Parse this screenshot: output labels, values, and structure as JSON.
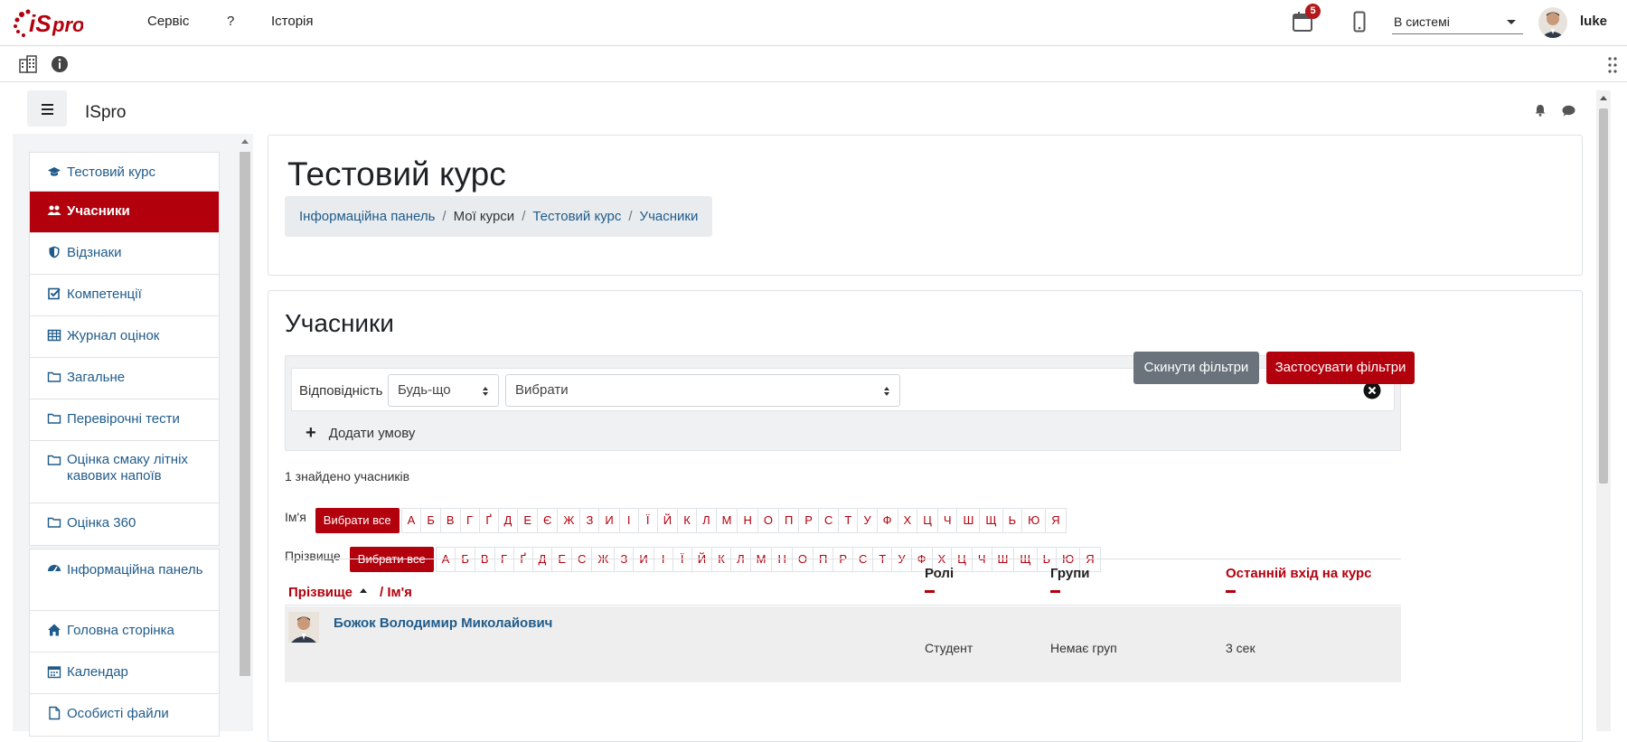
{
  "topbar": {
    "logo_text": "ISpro",
    "menu": [
      "Сервіс",
      "?",
      "Історія"
    ],
    "calendar_badge": "5",
    "status_select": "В системі",
    "username": "luke"
  },
  "header": {
    "site_name": "ISpro"
  },
  "drawer": {
    "course_items": [
      {
        "label": "Тестовий курс",
        "icon": "graduation-cap-icon"
      },
      {
        "label": "Учасники",
        "icon": "users-icon",
        "active": true
      },
      {
        "label": "Відзнаки",
        "icon": "shield-icon"
      },
      {
        "label": "Компетенції",
        "icon": "check-square-icon"
      },
      {
        "label": "Журнал оцінок",
        "icon": "table-icon"
      },
      {
        "label": "Загальне",
        "icon": "folder-icon"
      },
      {
        "label": "Перевірочні тести",
        "icon": "folder-icon"
      },
      {
        "label": "Оцінка смаку літніх кавових напоїв",
        "icon": "folder-icon"
      },
      {
        "label": "Оцінка 360",
        "icon": "folder-icon"
      }
    ],
    "site_items": [
      {
        "label": "Інформаційна панель",
        "icon": "dashboard-icon"
      },
      {
        "label": "Головна сторінка",
        "icon": "home-icon"
      },
      {
        "label": "Календар",
        "icon": "calendar-icon"
      },
      {
        "label": "Особисті файли",
        "icon": "file-icon"
      }
    ]
  },
  "course": {
    "title": "Тестовий курс",
    "breadcrumb": [
      "Інформаційна панель",
      "Мої курси",
      "Тестовий курс",
      "Учасники"
    ]
  },
  "participants": {
    "title": "Учасники",
    "filter": {
      "match_label": "Відповідність",
      "match_value": "Будь-що",
      "type_value": "Вибрати",
      "add_condition": "Додати умову",
      "reset_label": "Скинути фільтри",
      "apply_label": "Застосувати фільтри"
    },
    "found_text": "1 знайдено учасників",
    "firstname_label": "Ім'я",
    "lastname_label": "Прізвище",
    "select_all": "Вибрати все",
    "letters": [
      "А",
      "Б",
      "В",
      "Г",
      "Ґ",
      "Д",
      "Е",
      "Є",
      "Ж",
      "З",
      "И",
      "І",
      "Ї",
      "Й",
      "К",
      "Л",
      "М",
      "Н",
      "О",
      "П",
      "Р",
      "С",
      "Т",
      "У",
      "Ф",
      "Х",
      "Ц",
      "Ч",
      "Ш",
      "Щ",
      "Ь",
      "Ю",
      "Я"
    ],
    "columns": {
      "lastname": "Прізвище",
      "firstname": "/ Ім'я",
      "roles": "Ролі",
      "groups": "Групи",
      "last_access": "Останній вхід на курс"
    },
    "rows": [
      {
        "name": "Божок Володимир Миколайович",
        "role": "Студент",
        "groups": "Немає груп",
        "last_access": "3 сек"
      }
    ]
  },
  "colors": {
    "accent": "#b3000d",
    "link": "#1f5b8a",
    "badge": "#b3191c"
  }
}
